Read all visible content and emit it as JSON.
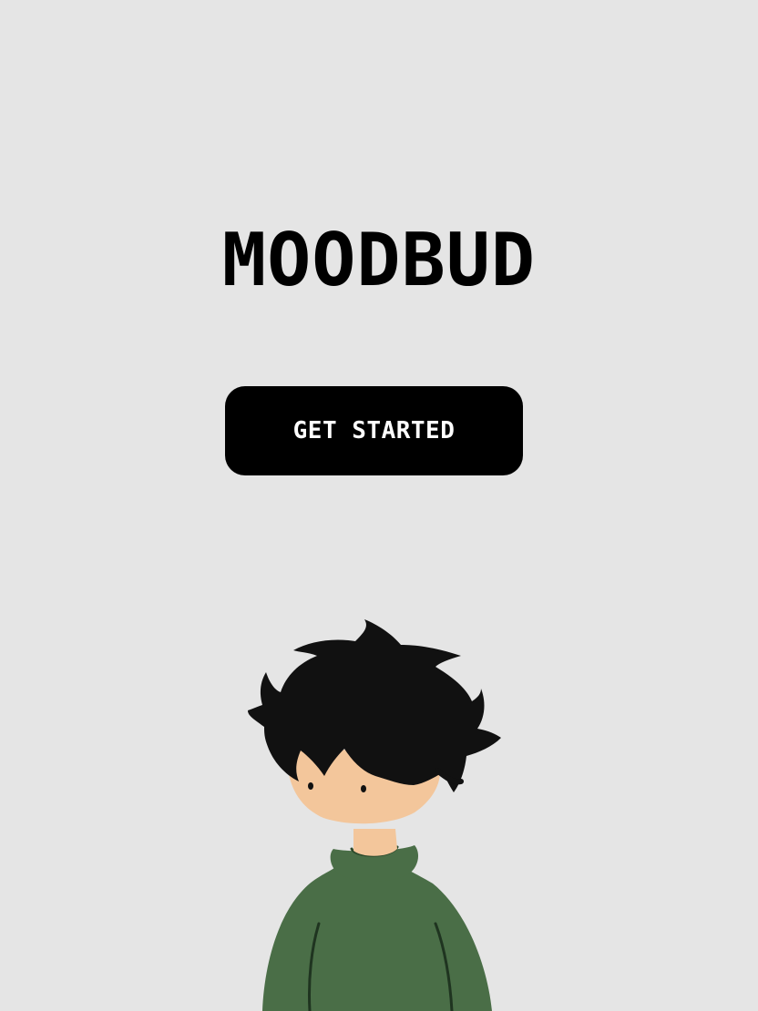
{
  "app": {
    "title": "MOODBUD"
  },
  "cta": {
    "label": "GET STARTED"
  },
  "colors": {
    "background": "#e5e5e5",
    "title": "#000000",
    "button_bg": "#000000",
    "button_text": "#ffffff",
    "hair": "#111111",
    "skin": "#f3c69b",
    "sweater": "#4a6e47"
  },
  "illustration": {
    "icon": "boy-character-illustration"
  }
}
